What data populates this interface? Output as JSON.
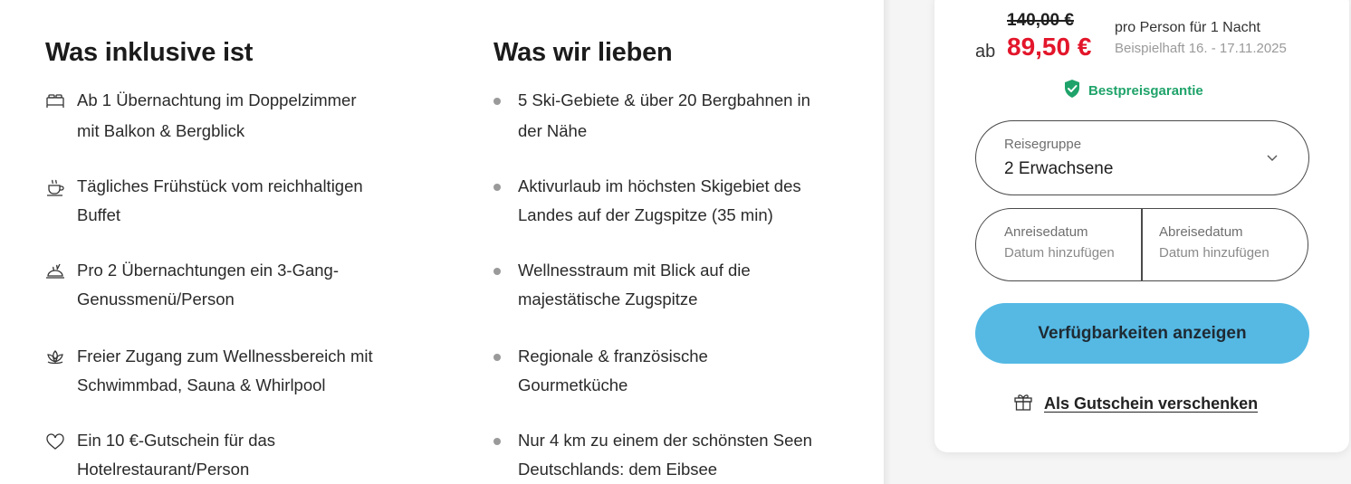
{
  "included": {
    "title": "Was inklusive ist",
    "items": [
      {
        "icon": "bed-icon",
        "line1": "Ab 1 Übernachtung im Doppelzimmer",
        "line2": "mit Balkon & Bergblick"
      },
      {
        "icon": "coffee-cup-icon",
        "line1": "Tägliches Frühstück vom reichhaltigen",
        "line2": "Buffet"
      },
      {
        "icon": "dish-icon",
        "line1": "Pro 2 Übernachtungen ein 3-Gang-",
        "line2": "Genussmenü/Person"
      },
      {
        "icon": "lotus-icon",
        "line1": "Freier Zugang zum Wellnessbereich mit",
        "line2": "Schwimmbad, Sauna & Whirlpool"
      },
      {
        "icon": "heart-icon",
        "line1": "Ein 10 €-Gutschein für das",
        "line2": "Hotelrestaurant/Person"
      }
    ]
  },
  "loves": {
    "title": "Was wir lieben",
    "items": [
      {
        "line1": "5 Ski-Gebiete & über 20 Bergbahnen in",
        "line2": "der Nähe"
      },
      {
        "line1": "Aktivurlaub im höchsten Skigebiet des",
        "line2": "Landes auf der Zugspitze (35 min)"
      },
      {
        "line1": "Wellnesstraum mit Blick auf die",
        "line2": "majestätische Zugspitze"
      },
      {
        "line1": "Regionale & französische",
        "line2": "Gourmetküche"
      },
      {
        "line1": "Nur 4 km zu einem der schönsten Seen",
        "line2": "Deutschlands: dem Eibsee"
      }
    ]
  },
  "booking": {
    "old_price": "140,00 €",
    "ab_label": "ab",
    "price": "89,50 €",
    "per_person": "pro Person für 1 Nacht",
    "example_date": "Beispielhaft 16. - 17.11.2025",
    "guarantee": "Bestpreisgarantie",
    "travel_group_label": "Reisegruppe",
    "travel_group_value": "2 Erwachsene",
    "arrival_label": "Anreisedatum",
    "arrival_placeholder": "Datum hinzufügen",
    "departure_label": "Abreisedatum",
    "departure_placeholder": "Datum hinzufügen",
    "cta": "Verfügbarkeiten anzeigen",
    "gift": "Als Gutschein verschenken"
  },
  "colors": {
    "price_red": "#e3162b",
    "guarantee_green": "#1fa36a",
    "cta_blue": "#55b9e4"
  }
}
